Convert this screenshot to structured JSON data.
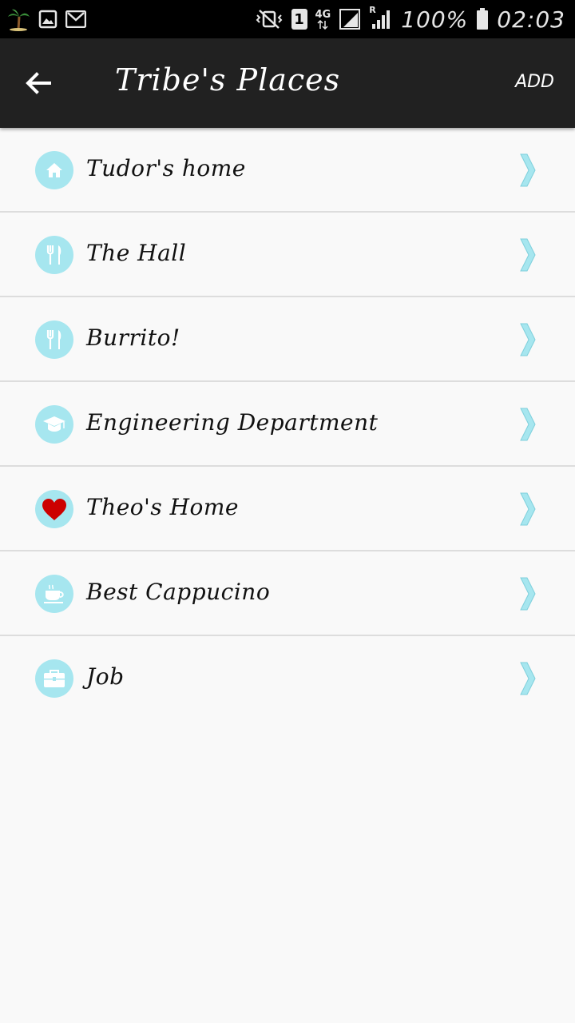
{
  "status_bar": {
    "sim_slot": "1",
    "network": "4G",
    "roaming": "R",
    "battery": "100%",
    "time": "02:03"
  },
  "app_bar": {
    "title": "Tribe's Places",
    "add_label": "ADD"
  },
  "colors": {
    "app_bar": "#212121",
    "icon_circle": "#a6e6ef",
    "chevron": "#a6e6ef",
    "heart": "#cc0000"
  },
  "places": [
    {
      "label": "Tudor's home",
      "icon": "home-icon"
    },
    {
      "label": "The Hall",
      "icon": "fork-knife-icon"
    },
    {
      "label": "Burrito!",
      "icon": "fork-knife-icon"
    },
    {
      "label": "Engineering Department",
      "icon": "graduation-cap-icon"
    },
    {
      "label": "Theo's Home",
      "icon": "heart-icon"
    },
    {
      "label": "Best Cappucino",
      "icon": "coffee-cup-icon"
    },
    {
      "label": "Job",
      "icon": "briefcase-icon"
    }
  ]
}
